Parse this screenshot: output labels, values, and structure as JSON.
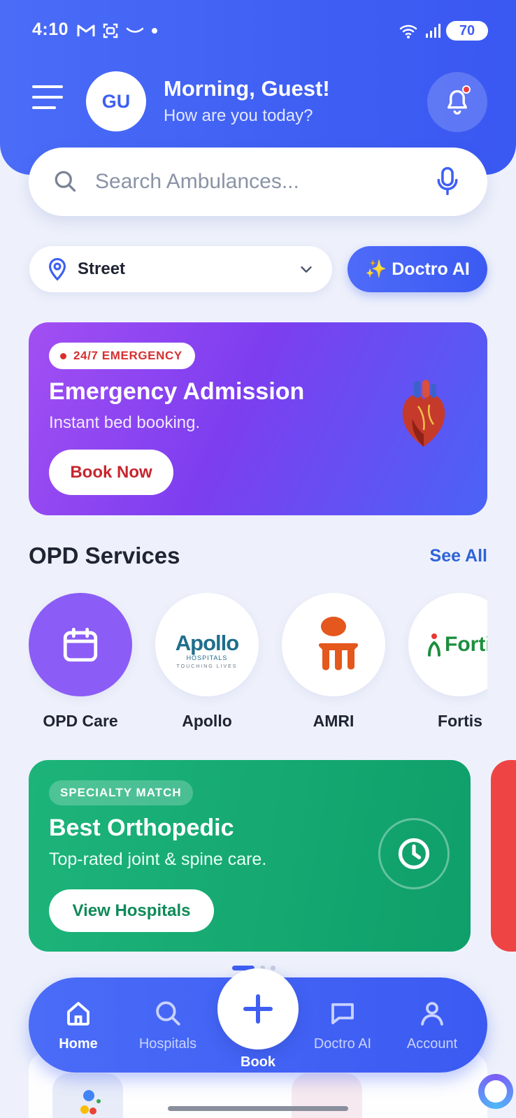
{
  "status_bar": {
    "time": "4:10",
    "battery": "70"
  },
  "header": {
    "avatar_initials": "GU",
    "greeting": "Morning, Guest!",
    "subtitle": "How are you today?"
  },
  "search": {
    "placeholder": "Search Ambulances..."
  },
  "location": {
    "label": "Street"
  },
  "ai_button": {
    "label": "✨ Doctro AI"
  },
  "emergency_card": {
    "badge": "24/7 EMERGENCY",
    "title": "Emergency Admission",
    "subtitle": "Instant bed booking.",
    "cta": "Book Now"
  },
  "opd": {
    "title": "OPD Services",
    "see_all": "See All",
    "items": [
      {
        "label": "OPD Care",
        "icon": "calendar-icon"
      },
      {
        "label": "Apollo",
        "logo_text": "Apollo",
        "logo_sub": "HOSPITALS",
        "logo_tag": "TOUCHING LIVES"
      },
      {
        "label": "AMRI",
        "icon": "amri-logo"
      },
      {
        "label": "Fortis",
        "logo_text": "Fortis"
      }
    ]
  },
  "specialty_card": {
    "badge": "SPECIALTY MATCH",
    "title": "Best Orthopedic",
    "subtitle": "Top-rated joint & spine care.",
    "cta": "View Hospitals"
  },
  "colors": {
    "primary": "#3f5ff3",
    "emergency_red": "#d63031",
    "specialty_green": "#0f9f6a",
    "opd_purple": "#8b5cf6"
  },
  "nav": {
    "items": [
      {
        "label": "Home",
        "icon": "home-icon",
        "active": true
      },
      {
        "label": "Hospitals",
        "icon": "search-icon"
      },
      {
        "label": "Doctro AI",
        "icon": "chat-icon"
      },
      {
        "label": "Account",
        "icon": "user-icon"
      }
    ],
    "fab_label": "Book"
  }
}
